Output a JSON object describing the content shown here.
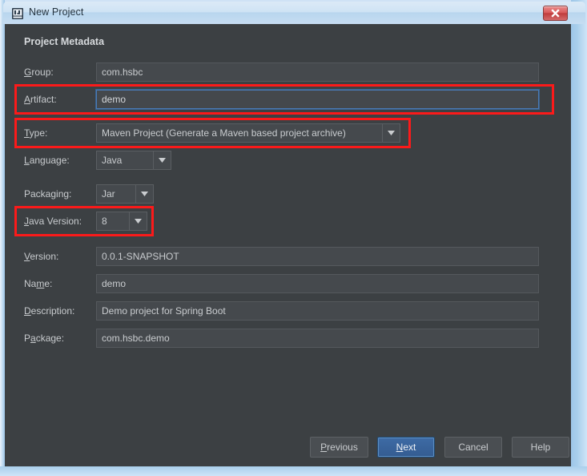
{
  "window": {
    "title": "New Project",
    "icon": "intellij-idea-icon",
    "close_label": "Close"
  },
  "dialog": {
    "heading": "Project Metadata",
    "background_color": "#3c4043",
    "accent_color": "#3e6ba5",
    "annotation_color": "#fb1a1a"
  },
  "fields": [
    {
      "name": "group",
      "label": "Group:",
      "mnemonic": "G",
      "value": "com.hsbc",
      "type": "text",
      "focused": false,
      "highlighted": false
    },
    {
      "name": "artifact",
      "label": "Artifact:",
      "mnemonic": "A",
      "value": "demo",
      "type": "text",
      "focused": true,
      "highlighted": true
    },
    {
      "name": "type",
      "label": "Type:",
      "mnemonic": "T",
      "value": "Maven Project (Generate a Maven based project archive)",
      "type": "combo",
      "focused": false,
      "highlighted": true
    },
    {
      "name": "language",
      "label": "Language:",
      "mnemonic": "L",
      "value": "Java",
      "type": "combo",
      "focused": false,
      "highlighted": false
    },
    {
      "name": "packaging",
      "label": "Packaging:",
      "mnemonic": "g",
      "value": "Jar",
      "type": "combo",
      "focused": false,
      "highlighted": false
    },
    {
      "name": "java-version",
      "label": "Java Version:",
      "mnemonic": "J",
      "value": "8",
      "type": "combo",
      "focused": false,
      "highlighted": true
    },
    {
      "name": "version",
      "label": "Version:",
      "mnemonic": "V",
      "value": "0.0.1-SNAPSHOT",
      "type": "text",
      "focused": false,
      "highlighted": false
    },
    {
      "name": "project-name",
      "label": "Name:",
      "mnemonic": "m",
      "value": "demo",
      "type": "text",
      "focused": false,
      "highlighted": false
    },
    {
      "name": "description",
      "label": "Description:",
      "mnemonic": "D",
      "value": "Demo project for Spring Boot",
      "type": "text",
      "focused": false,
      "highlighted": false
    },
    {
      "name": "package",
      "label": "Package:",
      "mnemonic": "a",
      "value": "com.hsbc.demo",
      "type": "text",
      "focused": false,
      "highlighted": false
    }
  ],
  "buttons": [
    {
      "name": "previous",
      "label": "Previous",
      "mnemonic": "P",
      "primary": false
    },
    {
      "name": "next",
      "label": "Next",
      "mnemonic": "N",
      "primary": true
    },
    {
      "name": "cancel",
      "label": "Cancel",
      "mnemonic": "",
      "primary": false
    },
    {
      "name": "help",
      "label": "Help",
      "mnemonic": "",
      "primary": false
    }
  ]
}
